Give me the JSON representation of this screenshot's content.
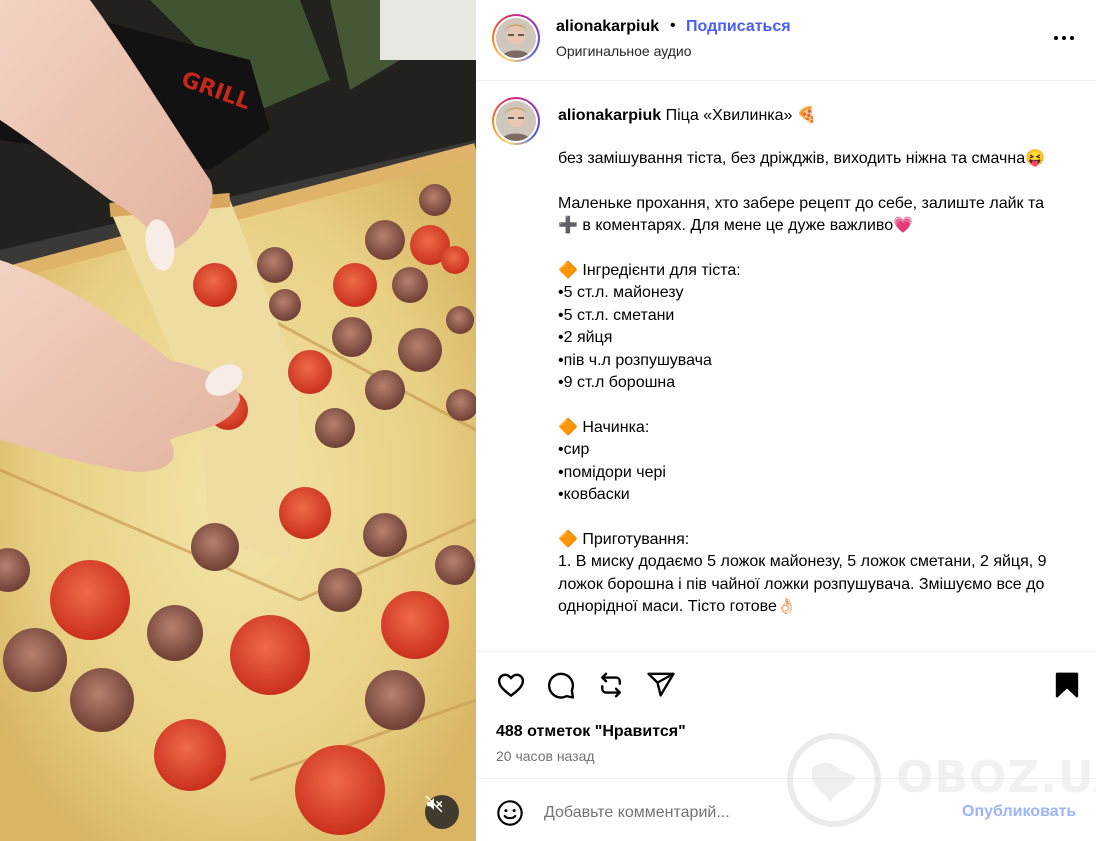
{
  "media": {
    "kind": "video",
    "mute_icon": "speaker-muted-icon",
    "box_print": "GRILL"
  },
  "header": {
    "username": "alionakarpiuk",
    "separator": "•",
    "follow_label": "Подписаться",
    "audio_label": "Оригинальное аудио",
    "more_icon": "more-options-icon"
  },
  "caption": {
    "username": "alionakarpiuk",
    "title": "Піца «Хвилинка» 🍕",
    "body": "без замішування тіста, без дріжджів, виходить ніжна та смачна😝\n\nМаленьке прохання, хто забере рецепт до себе, залиште лайк та ➕ в коментарях. Для мене це дуже важливо💗\n\n🔶 Інгредієнти для тіста:\n•5 ст.л. майонезу\n•5 ст.л. сметани\n•2 яйця\n•пів ч.л розпушувача\n•9 ст.л борошна\n\n🔶 Начинка:\n•сир\n•помідори чері\n•ковбаски\n\n🔶 Приготування:\n1. В миску додаємо 5 ложок майонезу, 5 ложок сметани, 2 яйця, 9 ложок борошна і пів чайної ложки розпушувача. Змішуємо все до однорідної маси. Тісто готове👌🏻"
  },
  "actions": {
    "icons": [
      "heart-icon",
      "comment-icon",
      "repost-icon",
      "share-icon",
      "bookmark-icon"
    ],
    "likes": "488 отметок \"Нравится\"",
    "time": "20 часов назад"
  },
  "comment": {
    "placeholder": "Добавьте комментарий...",
    "publish_label": "Опубликовать",
    "emoji_icon": "emoji-icon"
  },
  "watermark": {
    "text": "OBOZ.UA"
  },
  "colors": {
    "link_blue": "#4a5df9",
    "publish_disabled": "#9fb4f7",
    "secondary_text": "#737373",
    "divider": "#efefef"
  }
}
